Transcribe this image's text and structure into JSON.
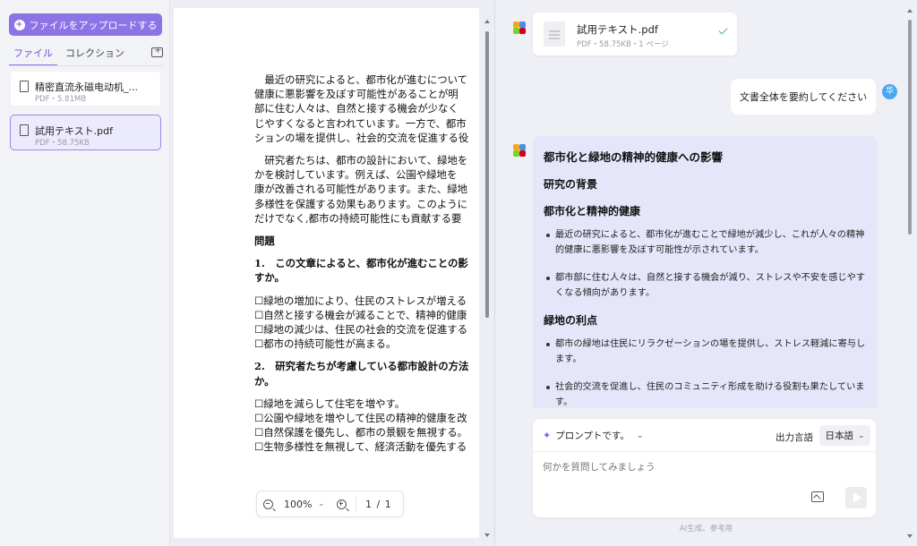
{
  "sidebar": {
    "upload_button": "ファイルをアップロードする",
    "tabs": [
      "ファイル",
      "コレクション"
    ],
    "files": [
      {
        "name": "精密直流永磁电动机_...",
        "meta": "PDF・5.81MB"
      },
      {
        "name": "試用テキスト.pdf",
        "meta": "PDF・58.75KB"
      }
    ]
  },
  "document": {
    "paragraphs": [
      {
        "style": "normal",
        "lines": [
          "　最近の研究によると、都市化が進むについて",
          "健康に悪影響を及ぼす可能性があることが明",
          "部に住む人々は、自然と接する機会が少なく",
          "じやすくなると言われています。一方で、都市",
          "ションの場を提供し、社会的交流を促進する役"
        ]
      },
      {
        "style": "normal",
        "lines": [
          "　研究者たちは、都市の設計において、緑地を",
          "かを検討しています。例えば、公園や緑地を",
          "康が改善される可能性があります。また、緑地",
          "多様性を保護する効果もあります。このように",
          "だけでなく,都市の持続可能性にも貢献する要"
        ]
      },
      {
        "style": "bold",
        "lines": [
          "問題"
        ]
      },
      {
        "style": "bold",
        "lines": [
          "1.　この文章によると、都市化が進むことの影",
          "すか。"
        ]
      },
      {
        "style": "normal",
        "lines": [
          "☐緑地の増加により、住民のストレスが増える",
          "☐自然と接する機会が減ることで、精神的健康",
          "☐緑地の減少は、住民の社会的交流を促進する",
          "☐都市の持続可能性が高まる。"
        ]
      },
      {
        "style": "bold",
        "lines": [
          "2.　研究者たちが考慮している都市設計の方法",
          "か。"
        ]
      },
      {
        "style": "normal",
        "lines": [
          "☐緑地を減らして住宅を増やす。",
          "☐公園や緑地を増やして住民の精神的健康を改",
          "☐自然保護を優先し、都市の景観を無視する。",
          "☐生物多様性を無視して、経済活動を優先する"
        ]
      }
    ],
    "zoom": "100%",
    "page": "1 / 1"
  },
  "chat": {
    "file_card": {
      "name": "試用テキスト.pdf",
      "meta": "PDF・58.75KB・1 ページ"
    },
    "user_message": "文書全体を要約してください",
    "user_avatar": "华",
    "answer": {
      "title": "都市化と緑地の精神的健康への影響",
      "sections": [
        {
          "heading": "研究の背景",
          "bullets": []
        },
        {
          "heading": "都市化と精神的健康",
          "bullets": [
            "最近の研究によると、都市化が進むことで緑地が減少し、これが人々の精神的健康に悪影響を及ぼす可能性が示されています。",
            "都市部に住む人々は、自然と接する機会が減り、ストレスや不安を感じやすくなる傾向があります。"
          ]
        },
        {
          "heading": "緑地の利点",
          "bullets": [
            "都市の緑地は住民にリラクゼーションの場を提供し、ストレス軽減に寄与します。",
            "社会的交流を促進し、住民のコミュニティ形成を助ける役割も果たしています。"
          ]
        }
      ]
    },
    "prompt_selector": "プロンプトです。",
    "output_language_label": "出力言語",
    "output_language": "日本語",
    "question_placeholder": "何かを質問してみましょう",
    "ai_note": "AI生成、参考用"
  },
  "colors": {
    "accent": "#8c73e6",
    "answer_bg": "#e6e6fb",
    "check": "#4fb07a",
    "avatar": "#4aa7f0"
  }
}
